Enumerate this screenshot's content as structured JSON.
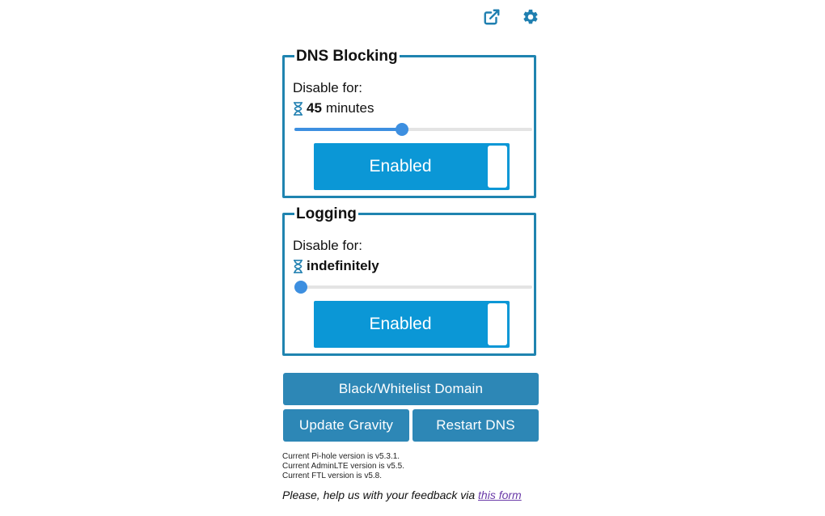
{
  "header": {
    "icons": [
      "external-link-icon",
      "gear-icon"
    ]
  },
  "accent_color": "#1f84b0",
  "dns_blocking": {
    "title": "DNS Blocking",
    "disable_label": "Disable for:",
    "duration_value": "45",
    "duration_unit": "minutes",
    "slider_fraction": 0.45,
    "toggle_label": "Enabled"
  },
  "logging": {
    "title": "Logging",
    "disable_label": "Disable for:",
    "duration_text": "indefinitely",
    "slider_fraction": 0.0,
    "toggle_label": "Enabled"
  },
  "buttons": {
    "list_domain": "Black/Whitelist Domain",
    "update_gravity": "Update Gravity",
    "restart_dns": "Restart DNS"
  },
  "versions": {
    "pihole": "Current Pi-hole version is v5.3.1.",
    "adminlte": "Current AdminLTE version is v5.5.",
    "ftl": "Current FTL version is v5.8."
  },
  "feedback": {
    "text": "Please, help us with your feedback via ",
    "link_text": "this form"
  }
}
